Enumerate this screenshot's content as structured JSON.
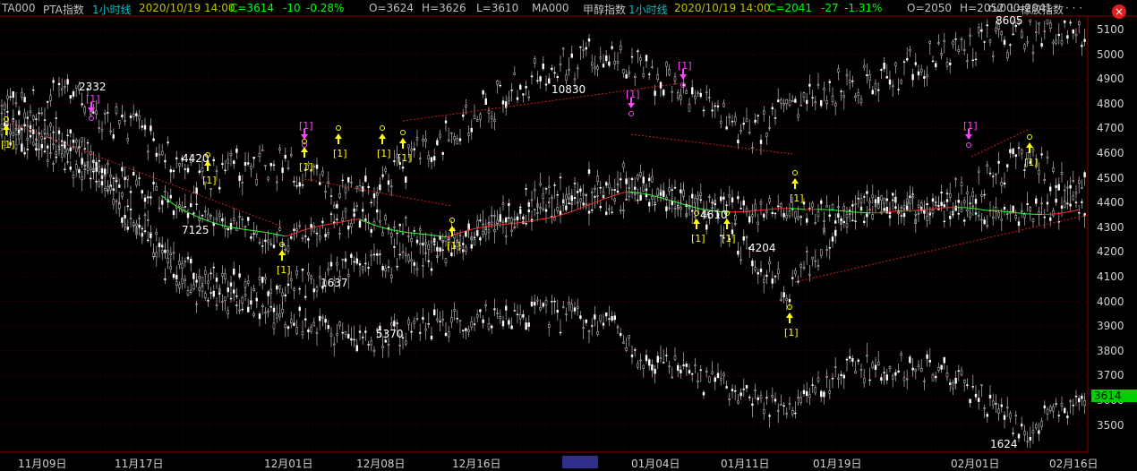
{
  "infobar": [
    {
      "key": "sym1",
      "text": "TA000",
      "color": "#c0c0c0"
    },
    {
      "key": "name1",
      "text": "PTA指数",
      "color": "#c0c0c0"
    },
    {
      "key": "period1",
      "text": "1小时线",
      "color": "#00c0c0"
    },
    {
      "key": "date1",
      "text": "2020/10/19 14:00",
      "color": "#c0c000"
    },
    {
      "key": "c1",
      "text": "C=3614",
      "color": "#00ff00"
    },
    {
      "key": "chg1",
      "text": "-10",
      "color": "#00ff00"
    },
    {
      "key": "pct1",
      "text": "-0.28%",
      "color": "#00ff00"
    },
    {
      "key": "o1",
      "text": "O=3624",
      "color": "#c0c0c0"
    },
    {
      "key": "h1",
      "text": "H=3626",
      "color": "#c0c0c0"
    },
    {
      "key": "l1",
      "text": "L=3610",
      "color": "#c0c0c0"
    },
    {
      "key": "sym2",
      "text": "MA000",
      "color": "#c0c0c0"
    },
    {
      "key": "name2",
      "text": "甲醇指数",
      "color": "#c0c0c0"
    },
    {
      "key": "period2",
      "text": "1小时线",
      "color": "#00c0c0"
    },
    {
      "key": "date2",
      "text": "2020/10/19 14:00",
      "color": "#c0c000"
    },
    {
      "key": "c2",
      "text": "C=2041",
      "color": "#00ff00"
    },
    {
      "key": "chg2",
      "text": "-27",
      "color": "#00ff00"
    },
    {
      "key": "pct2",
      "text": "-1.31%",
      "color": "#00ff00"
    },
    {
      "key": "o2",
      "text": "O=2050",
      "color": "#c0c0c0"
    },
    {
      "key": "h2",
      "text": "H=2052",
      "color": "#c0c0c0"
    },
    {
      "key": "l2",
      "text": "L=2041",
      "color": "#c0c0c0"
    },
    {
      "key": "sym3",
      "text": "ru000",
      "color": "#c0c0c0"
    },
    {
      "key": "name3",
      "text": "橡胶指数",
      "color": "#c0c0c0"
    },
    {
      "key": "more",
      "text": "· · ·",
      "color": "#c0c0c0"
    }
  ],
  "close_icon": "×",
  "price_axis": [
    "5100",
    "5000",
    "4900",
    "4800",
    "4700",
    "4600",
    "4500",
    "4400",
    "4300",
    "4200",
    "4100",
    "4000",
    "3900",
    "3800",
    "3700",
    "3600",
    "3500"
  ],
  "current_price": "3614",
  "date_axis": [
    "11月09日",
    "11月17日",
    "12月01日",
    "12月08日",
    "12月16日",
    "01月04日",
    "01月11日",
    "01月19日",
    "02月01日",
    "02月16日"
  ],
  "annotations": [
    "2332",
    "4420",
    "7125",
    "1637",
    "5370",
    "10830",
    "4610",
    "4204",
    "1624",
    "8605"
  ],
  "signal_label": "[1]",
  "colors": {
    "background": "#000000",
    "candle": "#ffffff",
    "grid": "#3a0000",
    "signal_buy": "#ffff00",
    "signal_sell": "#ff44ff",
    "trend_line": "#cc2020",
    "ma_up": "#ff3030",
    "ma_down": "#30ff30",
    "badge": "#00d000"
  }
}
